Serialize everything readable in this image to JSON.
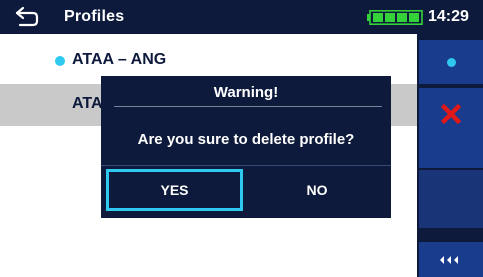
{
  "header": {
    "title": "Profiles",
    "back_icon": "back-arrow-icon",
    "battery_icon": "battery-icon",
    "time": "14:29"
  },
  "list": {
    "items": [
      {
        "label": "ATAA – ANG",
        "active": true
      },
      {
        "label": "ATA",
        "active": false
      }
    ]
  },
  "sidebar": {
    "buttons": [
      {
        "icon": "dot-icon"
      },
      {
        "icon": "delete-x-icon"
      },
      {
        "icon": ""
      },
      {
        "icon": "more-arrows-icon"
      }
    ]
  },
  "dialog": {
    "title": "Warning!",
    "message": "Are you sure to delete profile?",
    "yes_label": "YES",
    "no_label": "NO"
  },
  "colors": {
    "background_dark": "#0d1a3c",
    "accent": "#2fc8ee",
    "sidebar_button": "#1a3c8c",
    "delete_red": "#e01818",
    "battery_green": "#35d13a",
    "row_selected": "#c9c9c9"
  }
}
